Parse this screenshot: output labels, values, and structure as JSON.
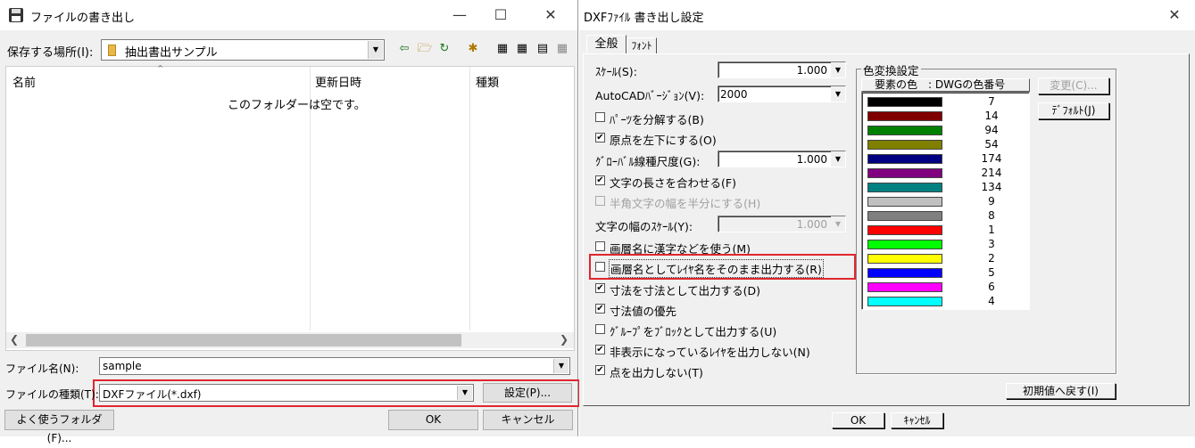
{
  "save_dialog": {
    "title": "ファイルの書き出し",
    "location_label": "保存する場所(I):",
    "location_value": "抽出書出サンプル",
    "columns": [
      "名前",
      "更新日時",
      "種類"
    ],
    "empty_message": "このフォルダーは空です。",
    "filename_label": "ファイル名(N):",
    "filename_value": "sample",
    "filetype_label": "ファイルの種類(T):",
    "filetype_value": "DXFファイル(*.dxf)",
    "settings_button": "設定(P)...",
    "favorites_button": "よく使うフォルダ(F)...",
    "ok_button": "OK",
    "cancel_button": "キャンセル",
    "highlight_color": "#e0262f"
  },
  "dxf_dialog": {
    "title": "DXFﾌｧｲﾙ 書き出し設定",
    "tabs": [
      "全般",
      "ﾌｫﾝﾄ"
    ],
    "scale_label": "ｽｹｰﾙ(S):",
    "scale_value": "1.000",
    "version_label": "AutoCADﾊﾞｰｼﾞｮﾝ(V):",
    "version_value": "2000",
    "opt_explode": "ﾊﾟｰﾂを分解する(B)",
    "opt_origin": "原点を左下にする(O)",
    "ltscale_label": "ｸﾞﾛｰﾊﾞﾙ線種尺度(G):",
    "ltscale_value": "1.000",
    "opt_textlen": "文字の長さを合わせる(F)",
    "opt_halfwidth": "半角文字の幅を半分にする(H)",
    "textscale_label": "文字の幅のｽｹｰﾙ(Y):",
    "textscale_value": "1.000",
    "opt_kanji": "画層名に漢字などを使う(M)",
    "opt_layername": "画層名としてﾚｲﾔ名をそのまま出力する(R)",
    "opt_dimension": "寸法を寸法として出力する(D)",
    "opt_dimvalue": "寸法値の優先",
    "opt_group": "ｸﾞﾙｰﾌﾟをﾌﾞﾛｯｸとして出力する(U)",
    "opt_hidden": "非表示になっているﾚｲﾔを出力しない(N)",
    "opt_points": "点を出力しない(T)",
    "color_group_label": "色変換設定",
    "color_header": "要素の色　: DWGの色番号",
    "change_button": "変更(C)...",
    "default_button": "ﾃﾞﾌｫﾙﾄ(J)",
    "reset_button": "初期値へ戻す(I)",
    "ok_button": "OK",
    "cancel_button": "ｷｬﾝｾﾙ",
    "colors": [
      {
        "hex": "#000000",
        "num": "7"
      },
      {
        "hex": "#800000",
        "num": "14"
      },
      {
        "hex": "#008000",
        "num": "94"
      },
      {
        "hex": "#808000",
        "num": "54"
      },
      {
        "hex": "#000080",
        "num": "174"
      },
      {
        "hex": "#800080",
        "num": "214"
      },
      {
        "hex": "#008080",
        "num": "134"
      },
      {
        "hex": "#c0c0c0",
        "num": "9"
      },
      {
        "hex": "#808080",
        "num": "8"
      },
      {
        "hex": "#ff0000",
        "num": "1"
      },
      {
        "hex": "#00ff00",
        "num": "3"
      },
      {
        "hex": "#ffff00",
        "num": "2"
      },
      {
        "hex": "#0000ff",
        "num": "5"
      },
      {
        "hex": "#ff00ff",
        "num": "6"
      },
      {
        "hex": "#00ffff",
        "num": "4"
      }
    ]
  }
}
